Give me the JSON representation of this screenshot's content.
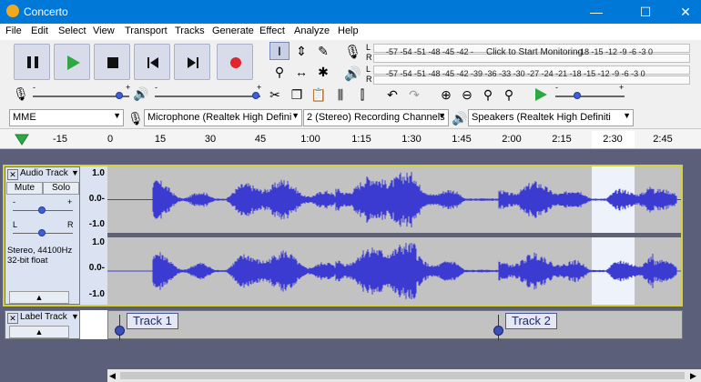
{
  "window": {
    "title": "Concerto",
    "minimize": "—",
    "maximize": "☐",
    "close": "✕"
  },
  "menu": [
    "File",
    "Edit",
    "Select",
    "View",
    "Transport",
    "Tracks",
    "Generate",
    "Effect",
    "Analyze",
    "Help"
  ],
  "transport": {
    "pause": "pause-icon",
    "play": "play-icon",
    "stop": "stop-icon",
    "skip_start": "skip-start-icon",
    "skip_end": "skip-end-icon",
    "record": "record-icon"
  },
  "meters": {
    "rec_scale": "-57 -54 -51 -48 -45 -42 -",
    "rec_prompt": "Click to Start Monitoring",
    "rec_scale_right": "-18 -15 -12  -9  -6  -3  0",
    "play_scale": "-57 -54 -51 -48 -45 -42 -39 -36 -33 -30 -27 -24 -21 -18 -15 -12  -9  -6  -3  0",
    "L": "L",
    "R": "R"
  },
  "mixer": {
    "minus": "-",
    "plus": "+"
  },
  "devices": {
    "host": "MME",
    "mic": "Microphone (Realtek High Defini",
    "channels": "2 (Stereo) Recording Channels",
    "speakers": "Speakers (Realtek High Definiti"
  },
  "ruler": {
    "ticks": [
      "-15",
      "0",
      "15",
      "30",
      "45",
      "1:00",
      "1:15",
      "1:30",
      "1:45",
      "2:00",
      "2:15",
      "2:30",
      "2:45"
    ]
  },
  "audio_track": {
    "name": "Audio Track",
    "mute": "Mute",
    "solo": "Solo",
    "gain_minus": "-",
    "gain_plus": "+",
    "pan_left": "L",
    "pan_right": "R",
    "info_line1": "Stereo, 44100Hz",
    "info_line2": "32-bit float",
    "scale": [
      "1.0",
      "0.0-",
      "-1.0"
    ]
  },
  "label_track": {
    "name": "Label Track",
    "labels": [
      "Track 1",
      "Track 2"
    ]
  },
  "colors": {
    "wave": "#3b3bd1",
    "accent": "#0078d7"
  }
}
